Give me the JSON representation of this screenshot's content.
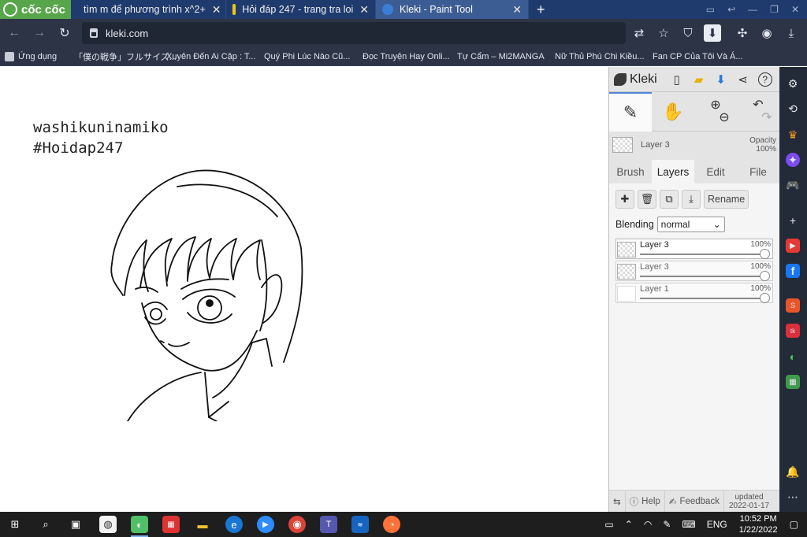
{
  "browser": {
    "brand": "cốc cốc",
    "tabs": [
      {
        "title": "tìm m để phương trình x^2+",
        "color": "#5fbf4a"
      },
      {
        "title": "Hỏi đáp 247 - trang tra loi",
        "color": "#f0c419"
      },
      {
        "title": "Kleki - Paint Tool",
        "color": "#3b7ed8",
        "active": true
      }
    ],
    "url": "kleki.com",
    "bookmarks": [
      {
        "label": "Ứng dụng",
        "color": "#c6cbd6"
      },
      {
        "label": "「僕の戦争」フルサイズ...",
        "color": "#e53935"
      },
      {
        "label": "Xuyên Đến Ai Cập : T...",
        "color": "#f2b705"
      },
      {
        "label": "Quý Phi Lúc Nào Cũ...",
        "color": "#f2b705"
      },
      {
        "label": "Đọc Truyện Hay Onli...",
        "color": "#8a8f9c"
      },
      {
        "label": "Tự Cẩm – Mi2MANGA",
        "color": "#d81b60"
      },
      {
        "label": "Nữ Thủ Phú Chi Kiều...",
        "color": "#8a8f9c"
      },
      {
        "label": "Fan CP Của Tôi Và Á...",
        "color": "#e53935"
      }
    ]
  },
  "canvas": {
    "line1": "washikuninamiko",
    "line2": "#Hoidap247"
  },
  "kleki": {
    "brand": "Kleki",
    "current_layer": "Layer 3",
    "opacity_label": "Opacity",
    "opacity_value": "100%",
    "tabs": [
      "Brush",
      "Layers",
      "Edit",
      "File"
    ],
    "rename": "Rename",
    "blending_label": "Blending",
    "blending_value": "normal",
    "layers": [
      {
        "name": "Layer 3",
        "opacity": "100%",
        "opacity_fraction": 1.0,
        "selected": true
      },
      {
        "name": "Layer 3",
        "opacity": "100%",
        "opacity_fraction": 1.0
      },
      {
        "name": "Layer 1",
        "opacity": "100%",
        "opacity_fraction": 1.0
      }
    ],
    "footer": {
      "help": "Help",
      "feedback": "Feedback",
      "updated_label": "updated",
      "updated_date": "2022-01-17"
    }
  },
  "taskbar": {
    "lang": "ENG",
    "time": "10:52 PM",
    "date": "1/22/2022"
  }
}
